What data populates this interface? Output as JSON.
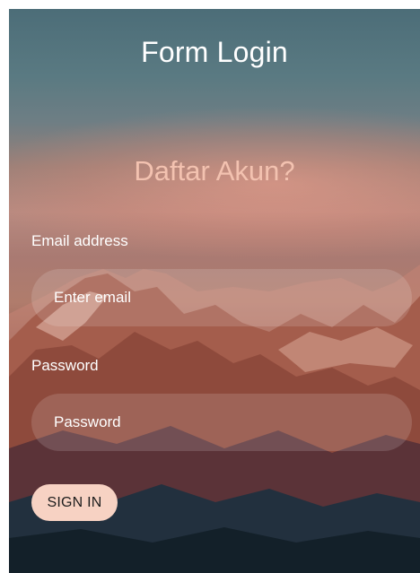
{
  "page": {
    "title": "Form Login",
    "subtitle": "Daftar Akun?"
  },
  "form": {
    "email_label": "Email address",
    "email_placeholder": "Enter email",
    "email_value": "",
    "password_label": "Password",
    "password_placeholder": "Password",
    "password_value": "",
    "submit_label": "SIGN IN"
  },
  "colors": {
    "title": "#ffffff",
    "subtitle": "#f3c2b0",
    "button_bg": "#f7d2c3",
    "button_text": "#1d1d1d"
  },
  "background": {
    "image": "mountain-sunset-background"
  }
}
